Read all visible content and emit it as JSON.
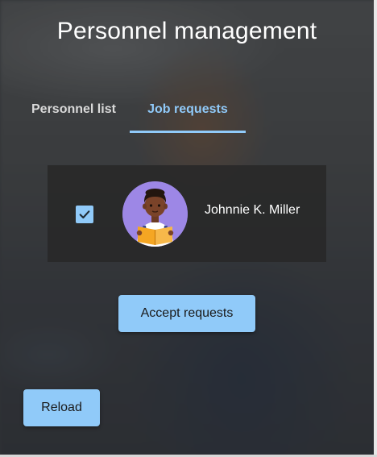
{
  "header": {
    "title": "Personnel management"
  },
  "tabs": [
    {
      "label": "Personnel list",
      "active": false
    },
    {
      "label": "Job requests",
      "active": true
    }
  ],
  "job_requests": [
    {
      "name": "Johnnie K. Miller",
      "checked": true,
      "avatar_icon": "reading-person-avatar"
    }
  ],
  "actions": {
    "accept_label": "Accept requests",
    "reload_label": "Reload"
  },
  "colors": {
    "accent": "#90caf9",
    "card_background": "#282828",
    "avatar_background": "#9d87e6",
    "title_text": "#ffffff"
  }
}
